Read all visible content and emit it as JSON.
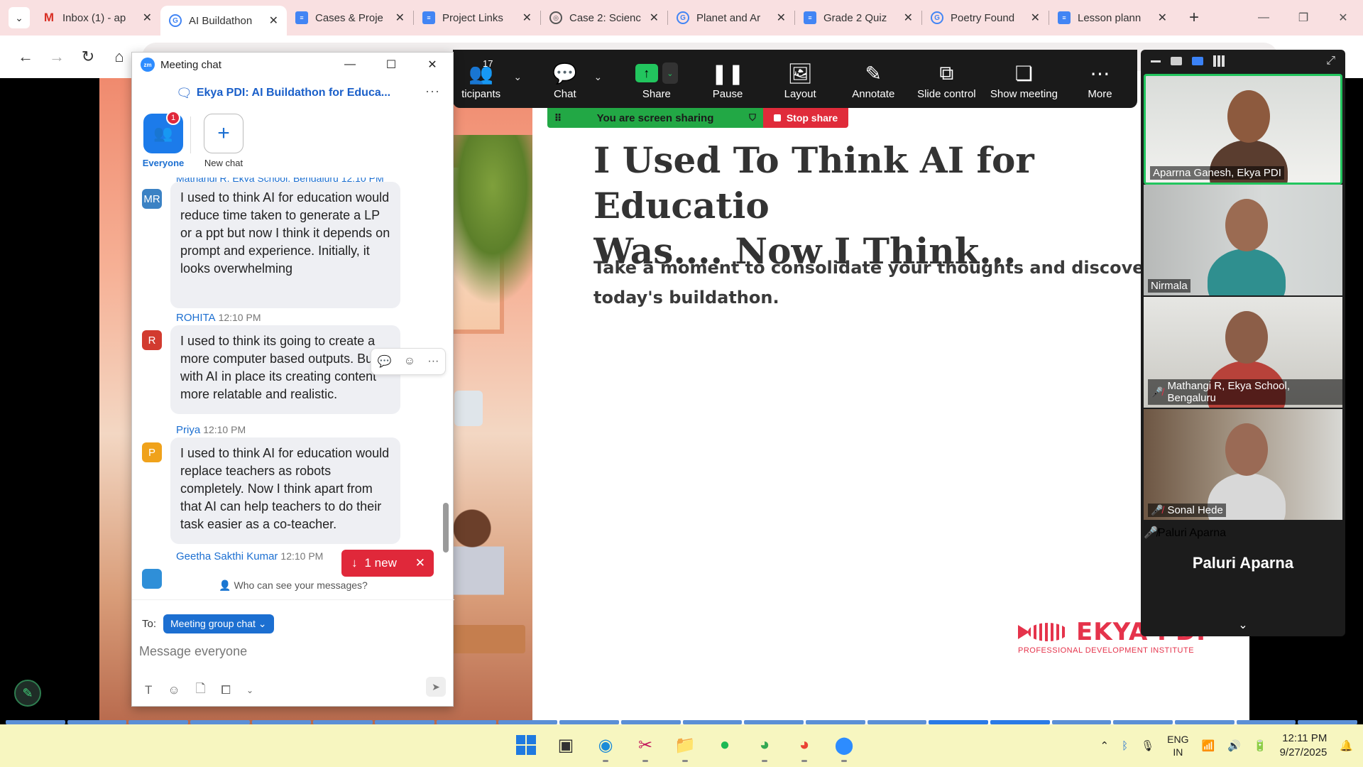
{
  "browser": {
    "tabs": [
      {
        "title": "Inbox (1) - ap",
        "icon": "gmail-icon",
        "active": false
      },
      {
        "title": "AI Buildathon",
        "icon": "google-icon",
        "active": true
      },
      {
        "title": "Cases & Proje",
        "icon": "docs-icon",
        "active": false
      },
      {
        "title": "Project Links",
        "icon": "docs-icon",
        "active": false
      },
      {
        "title": "Case 2: Scienc",
        "icon": "globe-icon",
        "active": false
      },
      {
        "title": "Planet and Ar",
        "icon": "google-icon",
        "active": false
      },
      {
        "title": "Grade 2 Quiz",
        "icon": "docs-icon",
        "active": false
      },
      {
        "title": "Poetry Found",
        "icon": "google-icon",
        "active": false
      },
      {
        "title": "Lesson plann",
        "icon": "docs-icon",
        "active": false
      }
    ]
  },
  "zoom_toolbar": {
    "participants_label": "ticipants",
    "participants_count": "17",
    "chat_label": "Chat",
    "share_label": "Share",
    "pause_label": "Pause",
    "layout_label": "Layout",
    "annotate_label": "Annotate",
    "slide_control_label": "Slide control",
    "show_meeting_label": "Show meeting",
    "more_label": "More"
  },
  "share_banner": {
    "text": "You are screen sharing",
    "stop_label": "Stop share"
  },
  "slide": {
    "title": "I Used To Think AI for Educatio\nWas.... Now I Think...",
    "subtitle": "Take a moment to consolidate your thoughts and discoveries today's buildathon.",
    "logo_brand": "EKYA PDI",
    "logo_tagline": "PROFESSIONAL DEVELOPMENT INSTITUTE"
  },
  "videos": [
    {
      "name": "Aparrna Ganesh, Ekya PDI",
      "muted": false,
      "active": true
    },
    {
      "name": "Nirmala",
      "muted": false,
      "active": false
    },
    {
      "name": "Mathangi R, Ekya School, Bengaluru",
      "muted": true,
      "active": false
    },
    {
      "name": "Sonal Hede",
      "muted": true,
      "active": false
    },
    {
      "name": "Paluri Aparna",
      "muted": true,
      "active": false,
      "display_name": "Paluri Aparna"
    }
  ],
  "chat": {
    "window_title": "Meeting chat",
    "header_name": "Ekya PDI: AI Buildathon for Educa...",
    "rail": {
      "everyone_label": "Everyone",
      "everyone_badge": "1",
      "new_chat_label": "New chat"
    },
    "partial_top_meta": "Mathangi R, Ekya School, Bengaluru 12:10 PM",
    "messages": [
      {
        "initials": "MR",
        "sender": "",
        "time": "",
        "color": "#3b82c4",
        "text": "I used to think AI for education would reduce time taken to generate a LP or a ppt but now I think it depends on prompt and experience. Initially, it looks overwhelming"
      },
      {
        "initials": "R",
        "sender": "ROHITA",
        "time": "12:10 PM",
        "color": "#d23b2f",
        "text": "I used to think its going to create a more computer based outputs. But with AI in place its creating content more relatable and realistic."
      },
      {
        "initials": "P",
        "sender": "Priya",
        "time": "12:10 PM",
        "color": "#f0a21b",
        "text": "I used to think AI for education would replace teachers as robots completely. Now I think apart from that AI can help teachers to do their task easier as a co-teacher."
      },
      {
        "initials": "",
        "sender": "Geetha Sakthi Kumar",
        "time": "12:10 PM",
        "color": "#2f8fd8",
        "text": ""
      }
    ],
    "new_messages_label": "1 new",
    "privacy_label": "Who can see your messages?",
    "to_label": "To:",
    "to_chip": "Meeting group chat",
    "input_placeholder": "Message everyone"
  },
  "taskbar": {
    "language_top": "ENG",
    "language_bottom": "IN",
    "time": "12:11 PM",
    "date": "9/27/2025"
  }
}
